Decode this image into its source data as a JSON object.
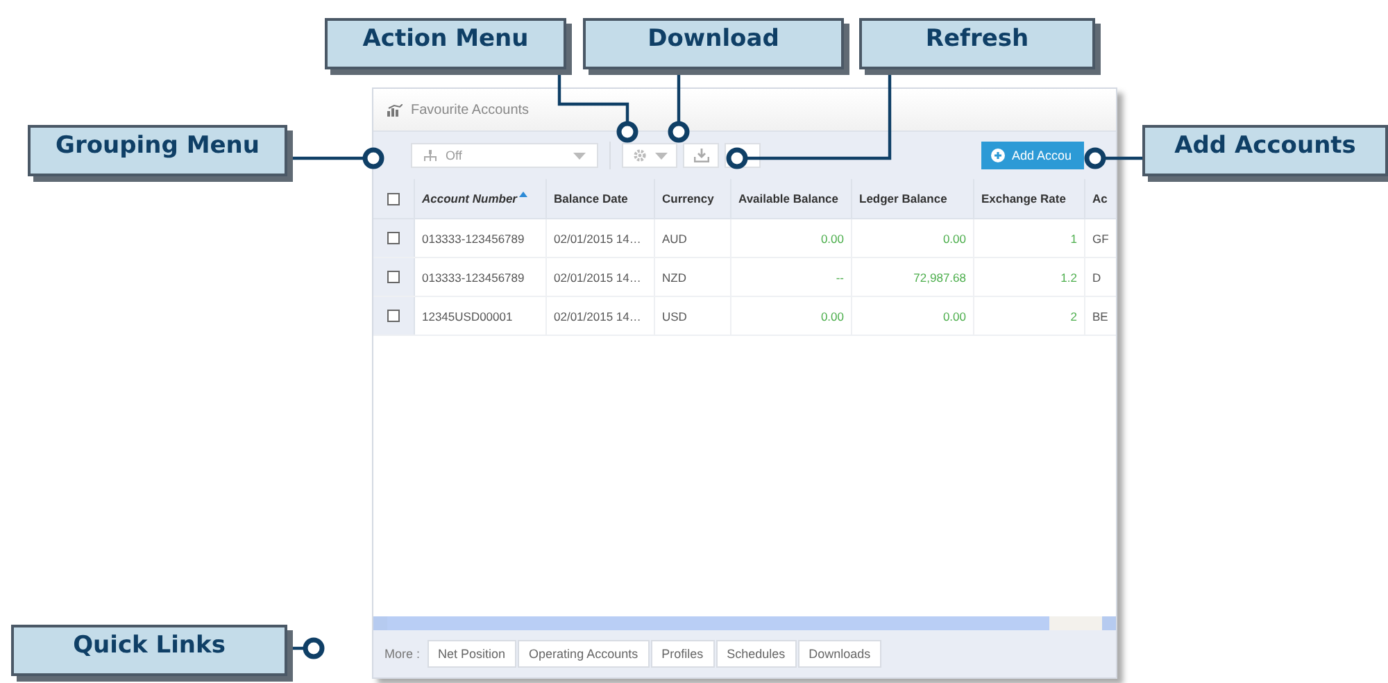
{
  "panel": {
    "title": "Favourite Accounts",
    "grouping": {
      "value": "Off"
    },
    "add_button": "Add Accou",
    "table": {
      "columns": [
        {
          "label": "Account Number",
          "sorted": true,
          "kind": "text"
        },
        {
          "label": "Balance Date",
          "sorted": false,
          "kind": "text"
        },
        {
          "label": "Currency",
          "sorted": false,
          "kind": "text"
        },
        {
          "label": "Available Balance",
          "sorted": false,
          "kind": "amount"
        },
        {
          "label": "Ledger Balance",
          "sorted": false,
          "kind": "amount"
        },
        {
          "label": "Exchange Rate",
          "sorted": false,
          "kind": "amount"
        },
        {
          "label": "Ac",
          "sorted": false,
          "kind": "text"
        }
      ],
      "header_checked": false,
      "rows": [
        {
          "checked": false,
          "cells": [
            "013333-123456789",
            "02/01/2015 14…",
            "AUD",
            "0.00",
            "0.00",
            "1",
            "GF"
          ]
        },
        {
          "checked": false,
          "cells": [
            "013333-123456789",
            "02/01/2015 14…",
            "NZD",
            "--",
            "72,987.68",
            "1.2",
            "D"
          ]
        },
        {
          "checked": false,
          "cells": [
            "12345USD00001",
            "02/01/2015 14…",
            "USD",
            "0.00",
            "0.00",
            "2",
            "BE"
          ]
        }
      ]
    },
    "quick_links": {
      "label": "More :",
      "links": [
        "Net Position",
        "Operating Accounts",
        "Profiles",
        "Schedules",
        "Downloads"
      ]
    }
  },
  "callouts": [
    {
      "label": "Action Menu"
    },
    {
      "label": "Download"
    },
    {
      "label": "Refresh"
    },
    {
      "label": "Grouping Menu"
    },
    {
      "label": "Add Accounts"
    },
    {
      "label": "Quick Links"
    }
  ]
}
